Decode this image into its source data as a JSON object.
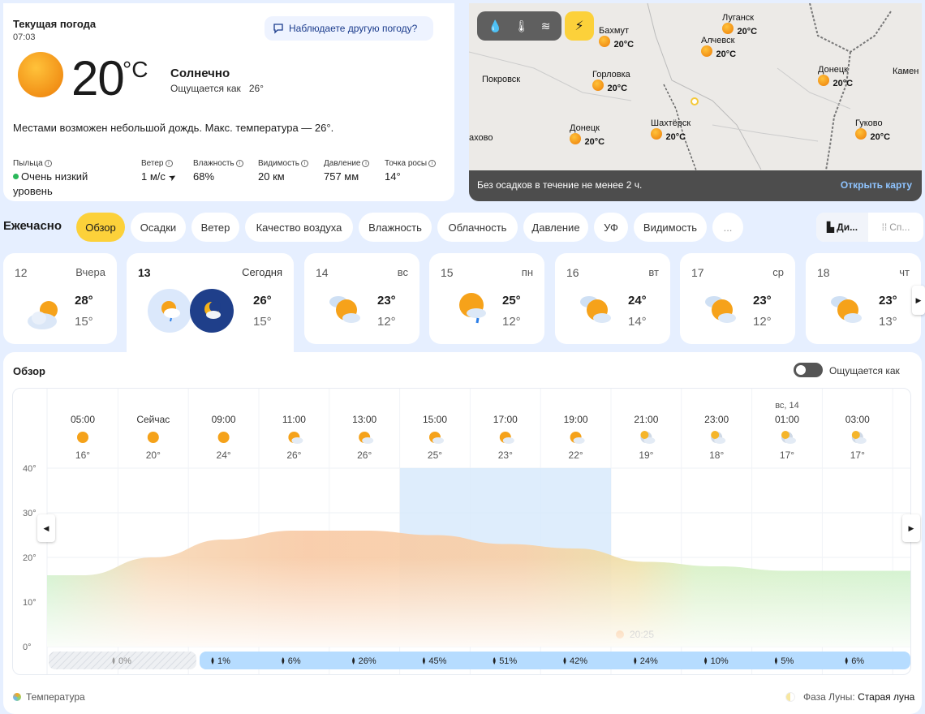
{
  "current": {
    "title": "Текущая погода",
    "time": "07:03",
    "other_weather": "Наблюдаете другую погоду?",
    "temperature": "20",
    "unit": "°C",
    "condition": "Солнечно",
    "feels_label": "Ощущается как",
    "feels_value": "26°",
    "description": "Местами возможен небольшой дождь. Макс. температура — 26°.",
    "metrics": {
      "pollen": {
        "label": "Пыльца",
        "value_line1": "Очень низкий",
        "value_line2": "уровень"
      },
      "wind": {
        "label": "Ветер",
        "value": "1 м/с"
      },
      "humidity": {
        "label": "Влажность",
        "value": "68%"
      },
      "visibility": {
        "label": "Видимость",
        "value": "20 км"
      },
      "pressure": {
        "label": "Давление",
        "value": "757 мм"
      },
      "dew": {
        "label": "Точка росы",
        "value": "14°"
      }
    }
  },
  "map": {
    "message": "Без осадков в течение не менее 2 ч.",
    "open": "Открыть карту",
    "cities": [
      {
        "name": "Луганск",
        "temp": "20°C"
      },
      {
        "name": "Бахмут",
        "temp": "20°C"
      },
      {
        "name": "Алчевск",
        "temp": "20°C"
      },
      {
        "name": "Покровск",
        "temp": ""
      },
      {
        "name": "Горловка",
        "temp": "20°C"
      },
      {
        "name": "Донецк",
        "temp": "20°C"
      },
      {
        "name": "Камен",
        "temp": ""
      },
      {
        "name": "Шахтёрск",
        "temp": "20°C"
      },
      {
        "name": "Донецк",
        "temp": "20°C"
      },
      {
        "name": "Гуково",
        "temp": "20°C"
      },
      {
        "name": "ахово",
        "temp": ""
      }
    ]
  },
  "hourly": {
    "title": "Ежечасно",
    "tabs": [
      "Обзор",
      "Осадки",
      "Ветер",
      "Качество воздуха",
      "Влажность",
      "Облачность",
      "Давление",
      "УФ",
      "Видимость",
      "..."
    ],
    "view_diagram": "Ди...",
    "view_list": "Сп..."
  },
  "days": [
    {
      "num": "12",
      "wd": "Вчера",
      "hi": "28°",
      "lo": "15°"
    },
    {
      "num": "13",
      "wd": "Сегодня",
      "hi": "26°",
      "lo": "15°"
    },
    {
      "num": "14",
      "wd": "вс",
      "hi": "23°",
      "lo": "12°"
    },
    {
      "num": "15",
      "wd": "пн",
      "hi": "25°",
      "lo": "12°"
    },
    {
      "num": "16",
      "wd": "вт",
      "hi": "24°",
      "lo": "14°"
    },
    {
      "num": "17",
      "wd": "ср",
      "hi": "23°",
      "lo": "12°"
    },
    {
      "num": "18",
      "wd": "чт",
      "hi": "23°",
      "lo": "13°"
    }
  ],
  "overview": {
    "title": "Обзор",
    "feels_toggle": "Ощущается как",
    "sunset": "20:25",
    "next_day_label": "вс, 14",
    "legend_temp": "Температура",
    "moon_label": "Фаза Луны:",
    "moon_value": "Старая луна"
  },
  "chart_data": {
    "type": "area",
    "x": [
      "05:00",
      "Сейчас",
      "09:00",
      "11:00",
      "13:00",
      "15:00",
      "17:00",
      "19:00",
      "21:00",
      "23:00",
      "01:00",
      "03:00"
    ],
    "temperature": [
      16,
      20,
      24,
      26,
      26,
      25,
      23,
      22,
      19,
      18,
      17,
      17
    ],
    "temp_labels": [
      "16°",
      "20°",
      "24°",
      "26°",
      "26°",
      "25°",
      "23°",
      "22°",
      "19°",
      "18°",
      "17°",
      "17°"
    ],
    "precip_prob": [
      "0%",
      "1%",
      "6%",
      "26%",
      "45%",
      "51%",
      "42%",
      "24%",
      "10%",
      "5%",
      "6%"
    ],
    "y_ticks": [
      "40°",
      "30°",
      "20°",
      "10°",
      "0°"
    ],
    "ylim": [
      0,
      40
    ]
  }
}
